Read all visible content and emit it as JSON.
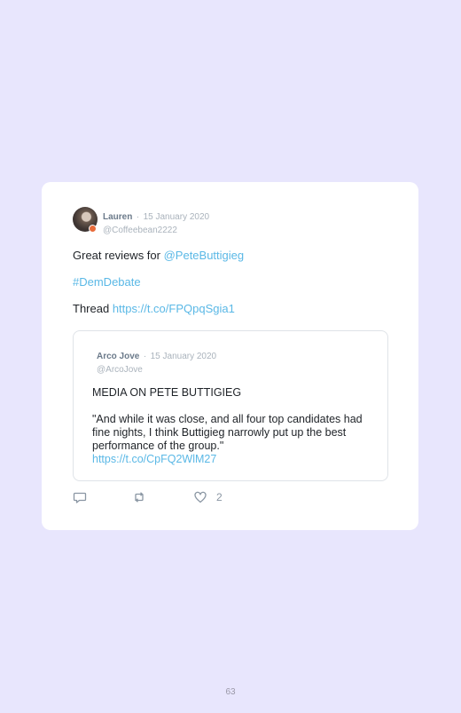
{
  "tweet": {
    "author": "Lauren",
    "separator": "·",
    "date": "15 January 2020",
    "handle": "@Coffeebean2222",
    "text": {
      "line1_prefix": "Great reviews for ",
      "line1_mention": "@PeteButtigieg",
      "hashtag": "#DemDebate",
      "line3_prefix": "Thread ",
      "line3_link": "https://t.co/FPQpqSgia1"
    },
    "like_count": "2"
  },
  "quoted_tweet": {
    "author": "Arco Jove",
    "separator": "·",
    "date": "15 January 2020",
    "handle": "@ArcoJove",
    "headline": "MEDIA ON PETE BUTTIGIEG",
    "quote": "\"And while it was close, and all four top candidates had fine nights, I think Buttigieg narrowly put up the best performance of the group.\"",
    "link": "https://t.co/CpFQ2WlM27"
  },
  "icons": {
    "reply": "reply-icon",
    "retweet": "retweet-icon",
    "like": "heart-icon"
  },
  "page_number": "63"
}
